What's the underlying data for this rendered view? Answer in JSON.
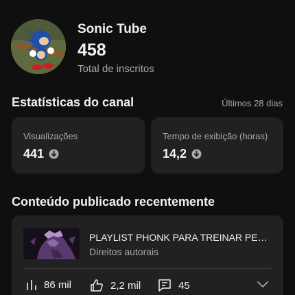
{
  "channel": {
    "name": "Sonic Tube",
    "subscribers": "458",
    "subscribers_label": "Total de inscritos"
  },
  "stats": {
    "title": "Estatísticas do canal",
    "range": "Últimos 28 dias",
    "views": {
      "label": "Visualizações",
      "value": "441",
      "trend_icon": "arrow-down-circle-icon"
    },
    "watch_time": {
      "label": "Tempo de exibição (horas)",
      "value": "14,2",
      "trend_icon": "arrow-down-circle-icon"
    }
  },
  "recent": {
    "title": "Conteúdo publicado recentemente",
    "video": {
      "title": "PLAYLIST PHONK PARA TREINAR PESADO",
      "status": "Direitos autorais",
      "views": "86 mil",
      "likes": "2,2 mil",
      "comments": "45"
    }
  },
  "colors": {
    "background": "#0f0f0f",
    "card": "#212121",
    "secondary_text": "#aaaaaa"
  }
}
